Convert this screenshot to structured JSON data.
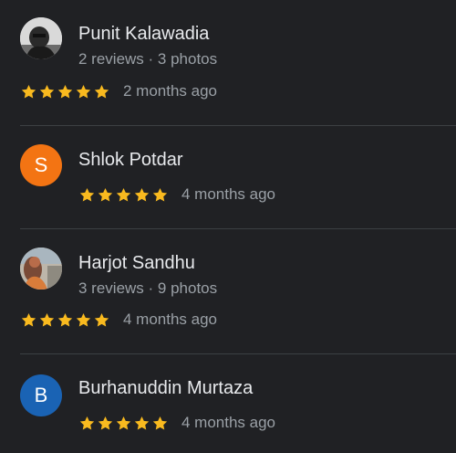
{
  "colors": {
    "background": "#202124",
    "name_text": "#e8eaed",
    "secondary_text": "#9aa0a6",
    "star": "#f9ba1f",
    "divider": "#3c4043",
    "avatar_orange": "#f37413",
    "avatar_blue": "#1a63b4"
  },
  "reviews": [
    {
      "name": "Punit Kalawadia",
      "meta": "2 reviews · 3 photos",
      "rating": 5,
      "date": "2 months ago",
      "avatar": "profile-photo"
    },
    {
      "name": "Shlok Potdar",
      "rating": 5,
      "date": "4 months ago",
      "avatar_letter": "S",
      "avatar": "letter-avatar-orange"
    },
    {
      "name": "Harjot Sandhu",
      "meta": "3 reviews · 9 photos",
      "rating": 5,
      "date": "4 months ago",
      "avatar": "profile-photo"
    },
    {
      "name": "Burhanuddin Murtaza",
      "rating": 5,
      "date": "4 months ago",
      "avatar_letter": "B",
      "avatar": "letter-avatar-blue"
    }
  ]
}
